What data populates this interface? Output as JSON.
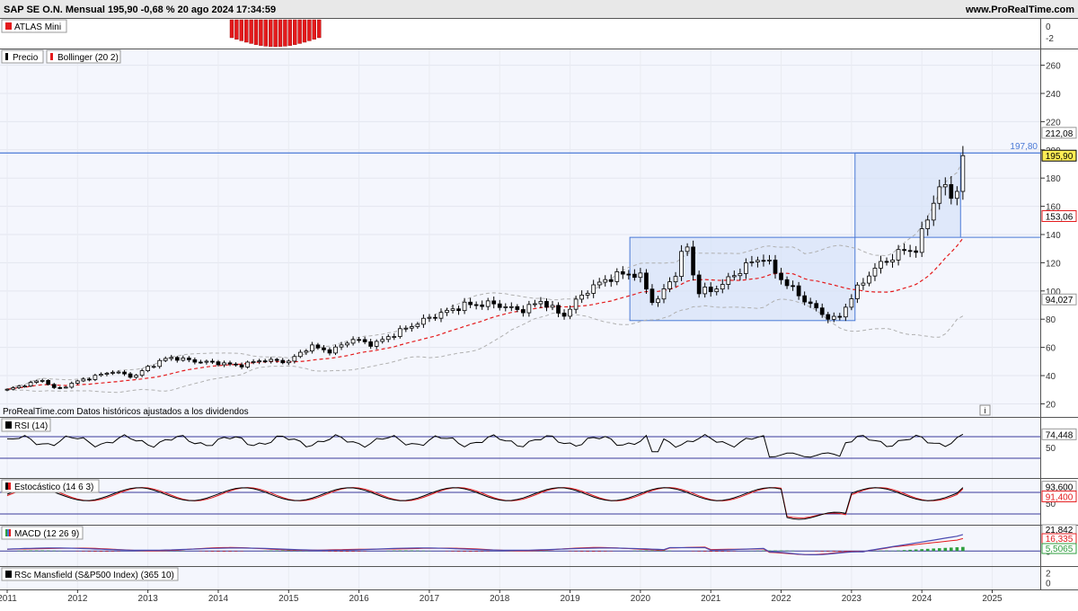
{
  "header": {
    "title": "SAP SE O.N. Mensual 195,90 -0,68 % 20 ago 2024 17:34:59",
    "site": "www.ProRealTime.com"
  },
  "panels": {
    "atlas": {
      "label": "ATLAS Mini",
      "ticks": [
        "0",
        "-2"
      ]
    },
    "price": {
      "label_precio": "Precio",
      "label_bollinger": "Bollinger (20 2)"
    },
    "rsi": {
      "label": "RSI (14)",
      "value": "74,448"
    },
    "stoch": {
      "label": "Estocástico (14 6 3)",
      "value1": "93,600",
      "value2": "91,400"
    },
    "macd": {
      "label": "MACD (12 26 9)",
      "value1": "21,842",
      "value2": "16,335",
      "value3": "5,5065"
    },
    "rsc": {
      "label": "RSc Mansfield (S&P500 Index) (365 10)"
    }
  },
  "footnote": "ProRealTime.com  Datos históricos ajustados a los dividendos",
  "info_icon": "i",
  "colors": {
    "up": "#ffffff",
    "down": "#000000",
    "bollinger_mid": "#e41a1c",
    "bollinger_band": "#b0b0b0",
    "box": "#4a79d6",
    "box_fill": "#d6e2f8",
    "macd_fill_up": "#4cb050",
    "macd_fill_dn": "#e05050",
    "hist_pos": "#2e9e3e",
    "hist_neg": "#d02020",
    "price_tag": "#ffee55"
  },
  "chart_data": [
    {
      "type": "candlestick",
      "title": "SAP SE O.N. Mensual",
      "x_labels": [
        "2011",
        "2012",
        "2013",
        "2014",
        "2015",
        "2016",
        "2017",
        "2018",
        "2019",
        "2020",
        "2021",
        "2022",
        "2023",
        "2024",
        "2025"
      ],
      "x_range": [
        2011.0,
        2025.3
      ],
      "y_ticks": [
        20,
        40,
        60,
        80,
        100,
        120,
        140,
        160,
        180,
        200,
        220,
        240,
        260
      ],
      "y_range": [
        12,
        268
      ],
      "last_price": "195,90",
      "resistance": {
        "value": 197.8,
        "label": "197,80"
      },
      "upper_band_label": "212,08",
      "mid_band_label": "153,06",
      "lower_band_label": "94,027",
      "range_box": {
        "x": [
          2019.85,
          2023.05
        ],
        "y": [
          79,
          138
        ]
      },
      "breakout_box": {
        "x": [
          2023.05,
          2024.55
        ],
        "y": [
          138,
          197.8
        ]
      },
      "anchors": [
        [
          2011.0,
          30
        ],
        [
          2011.5,
          37
        ],
        [
          2011.7,
          30
        ],
        [
          2012.0,
          36
        ],
        [
          2012.5,
          43
        ],
        [
          2012.8,
          39
        ],
        [
          2013.0,
          46
        ],
        [
          2013.3,
          53
        ],
        [
          2013.7,
          50
        ],
        [
          2014.0,
          49
        ],
        [
          2014.3,
          47
        ],
        [
          2014.6,
          51
        ],
        [
          2015.0,
          50
        ],
        [
          2015.3,
          61
        ],
        [
          2015.6,
          57
        ],
        [
          2015.9,
          66
        ],
        [
          2016.2,
          62
        ],
        [
          2016.6,
          72
        ],
        [
          2017.0,
          81
        ],
        [
          2017.5,
          90
        ],
        [
          2017.9,
          91
        ],
        [
          2018.3,
          86
        ],
        [
          2018.6,
          93
        ],
        [
          2018.9,
          82
        ],
        [
          2019.2,
          99
        ],
        [
          2019.5,
          108
        ],
        [
          2019.8,
          113
        ],
        [
          2020.0,
          110
        ],
        [
          2020.2,
          90
        ],
        [
          2020.5,
          113
        ],
        [
          2020.65,
          135
        ],
        [
          2020.8,
          100
        ],
        [
          2021.0,
          100
        ],
        [
          2021.2,
          106
        ],
        [
          2021.5,
          118
        ],
        [
          2021.75,
          124
        ],
        [
          2021.95,
          111
        ],
        [
          2022.3,
          95
        ],
        [
          2022.6,
          83
        ],
        [
          2022.8,
          79
        ],
        [
          2023.0,
          96
        ],
        [
          2023.3,
          115
        ],
        [
          2023.7,
          128
        ],
        [
          2023.95,
          130
        ],
        [
          2024.0,
          140
        ],
        [
          2024.25,
          175
        ],
        [
          2024.45,
          166
        ],
        [
          2024.55,
          180
        ],
        [
          2024.62,
          195.9
        ]
      ]
    },
    {
      "type": "line",
      "name": "RSI (14)",
      "y_ticks": [
        50
      ],
      "y_range": [
        0,
        100
      ],
      "levels": [
        70,
        30
      ],
      "last_value": "74,448"
    },
    {
      "type": "line",
      "name": "Estocástico (14 6 3)",
      "y_ticks": [
        50
      ],
      "y_range": [
        0,
        100
      ],
      "levels": [
        80,
        20
      ],
      "last_values": [
        "93,600",
        "91,400"
      ]
    },
    {
      "type": "area",
      "name": "MACD (12 26 9)",
      "y_ticks": [
        25,
        0
      ],
      "y_range": [
        -8,
        30
      ],
      "last_values": [
        "21,842",
        "16,335",
        "5,5065"
      ]
    },
    {
      "type": "line",
      "name": "RSc Mansfield (S&P500 Index) (365 10)",
      "y_ticks": [
        2,
        0
      ],
      "y_range": [
        -1,
        3
      ]
    }
  ]
}
